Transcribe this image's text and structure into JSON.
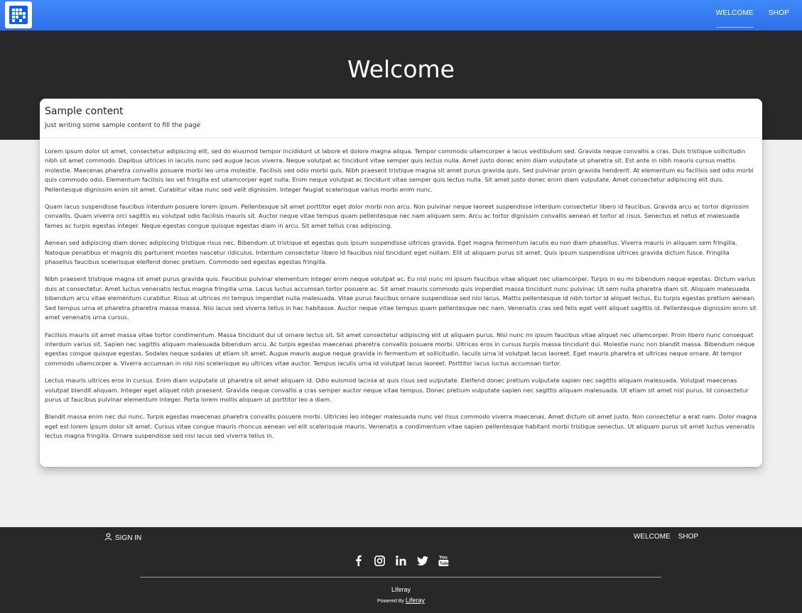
{
  "nav": {
    "welcome": "WELCOME",
    "shop": "SHOP"
  },
  "hero": {
    "title": "Welcome"
  },
  "card": {
    "title": "Sample content",
    "subtitle": "Just writing some sample content to fill the page",
    "paragraphs": [
      "Lorem ipsum dolor sit amet, consectetur adipiscing elit, sed do eiusmod tempor incididunt ut labore et dolore magna aliqua. Tempor commodo ullamcorper a lacus vestibulum sed. Gravida neque convallis a cras. Duis tristique sollicitudin nibh sit amet commodo. Dapibus ultrices in iaculis nunc sed augue lacus viverra. Neque volutpat ac tincidunt vitae semper quis lectus nulla. Amet justo donec enim diam vulputate ut pharetra sit. Est ante in nibh mauris cursus mattis molestie. Maecenas pharetra convallis posuere morbi leo urna molestie. Facilisis sed odio morbi quis. Nibh praesent tristique magna sit amet purus gravida quis. Sed pulvinar proin gravida hendrerit. At elementum eu facilisis sed odio morbi quis commodo odio. Elementum facilisis leo vel fringilla est ullamcorper eget nulla. Enim neque volutpat ac tincidunt vitae semper quis lectus nulla. Sit amet justo donec enim diam vulputate. Amet consectetur adipiscing elit duis. Pellentesque dignissim enim sit amet. Curabitur vitae nunc sed velit dignissim. Integer feugiat scelerisque varius morbi enim nunc.",
      "Quam lacus suspendisse faucibus interdum posuere lorem ipsum. Pellentesque sit amet porttitor eget dolor morbi non arcu. Non pulvinar neque laoreet suspendisse interdum consectetur libero id faucibus. Gravida arcu ac tortor dignissim convallis. Quam viverra orci sagittis eu volutpat odio facilisis mauris sit. Auctor neque vitae tempus quam pellentesque nec nam aliquam sem. Arcu ac tortor dignissim convallis aenean et tortor at risus. Senectus et netus et malesuada fames ac turpis egestas integer. Neque egestas congue quisque egestas diam in arcu. Sit amet tellus cras adipiscing.",
      "Aenean sed adipiscing diam donec adipiscing tristique risus nec. Bibendum ut tristique et egestas quis ipsum suspendisse ultrices gravida. Eget magna fermentum iaculis eu non diam phasellus. Viverra mauris in aliquam sem fringilla. Natoque penatibus et magnis dis parturient montes nascetur ridiculus. Interdum consectetur libero id faucibus nisl tincidunt eget nullam. Elit ut aliquam purus sit amet. Quis ipsum suspendisse ultrices gravida dictum fusce. Fringilla phasellus faucibus scelerisque eleifend donec pretium. Commodo sed egestas egestas fringilla.",
      "Nibh praesent tristique magna sit amet purus gravida quis. Faucibus pulvinar elementum integer enim neque volutpat ac. Eu nisl nunc mi ipsum faucibus vitae aliquet nec ullamcorper. Turpis in eu mi bibendum neque egestas. Dictum varius duis at consectetur. Amet luctus venenatis lectus magna fringilla urna. Lacus luctus accumsan tortor posuere ac. Sit amet mauris commodo quis imperdiet massa tincidunt nunc pulvinar. Ut sem nulla pharetra diam sit. Aliquam malesuada bibendum arcu vitae elementum curabitur. Risus at ultrices mi tempus imperdiet nulla malesuada. Vitae purus faucibus ornare suspendisse sed nisi lacus. Mattis pellentesque id nibh tortor id aliquet lectus. Eu turpis egestas pretium aenean. Sed tempus urna et pharetra pharetra massa massa. Nisi lacus sed viverra tellus in hac habitasse. Auctor neque vitae tempus quam pellentesque nec nam. Venenatis cras sed felis eget velit aliquet sagittis id. Pellentesque dignissim enim sit amet venenatis urna cursus.",
      "Facilisis mauris sit amet massa vitae tortor condimentum. Massa tincidunt dui ut ornare lectus sit. Sit amet consectetur adipiscing elit ut aliquam purus. Nisl nunc mi ipsum faucibus vitae aliquet nec ullamcorper. Proin libero nunc consequat interdum varius sit. Sapien nec sagittis aliquam malesuada bibendum arcu. Ac turpis egestas maecenas pharetra convallis posuere morbi. Ultrices eros in cursus turpis massa tincidunt dui. Molestie nunc non blandit massa. Bibendum neque egestas congue quisque egestas. Sodales neque sodales ut etiam sit amet. Augue mauris augue neque gravida in fermentum et sollicitudin. Iaculis urna id volutpat lacus laoreet. Eget mauris pharetra et ultrices neque ornare. At tempor commodo ullamcorper a. Viverra accumsan in nisl nisi scelerisque eu ultrices vitae auctor. Tempus iaculis urna id volutpat lacus laoreet. Porttitor lacus luctus accumsan tortor.",
      "Lectus mauris ultrices eros in cursus. Enim diam vulputate ut pharetra sit amet aliquam id. Odio euismod lacinia at quis risus sed vulputate. Eleifend donec pretium vulputate sapien nec sagittis aliquam malesuada. Volutpat maecenas volutpat blandit aliquam. Integer eget aliquet nibh praesent. Gravida neque convallis a cras semper auctor neque vitae tempus. Donec pretium vulputate sapien nec sagittis aliquam malesuada. Ut etiam sit amet nisl purus. Id consectetur purus ut faucibus pulvinar elementum integer. Porta lorem mollis aliquam ut porttitor leo a diam.",
      "Blandit massa enim nec dui nunc. Turpis egestas maecenas pharetra convallis posuere morbi. Ultricies leo integer malesuada nunc vel risus commodo viverra maecenas. Amet dictum sit amet justo. Non consectetur a erat nam. Dolor magna eget est lorem ipsum dolor sit amet. Cursus vitae congue mauris rhoncus aenean vel elit scelerisque mauris. Venenatis a condimentum vitae sapien pellentesque habitant morbi tristique senectus. Ut aliquam purus sit amet luctus venenatis lectus magna fringilla. Ornare suspendisse sed nisi lacus sed viverra tellus in."
    ]
  },
  "footer": {
    "sign_in": "SIGN IN",
    "nav": {
      "welcome": "WELCOME",
      "shop": "SHOP"
    },
    "social_icons": [
      "facebook-icon",
      "instagram-icon",
      "linkedin-icon",
      "twitter-icon",
      "youtube-icon"
    ],
    "brand": "Liferay",
    "powered_by": "Powered By",
    "powered_link": "Liferay"
  },
  "colors": {
    "topbar": "#2f6fea",
    "hero": "#282828",
    "page": "#efeff2",
    "accent": "#0b5fff"
  }
}
